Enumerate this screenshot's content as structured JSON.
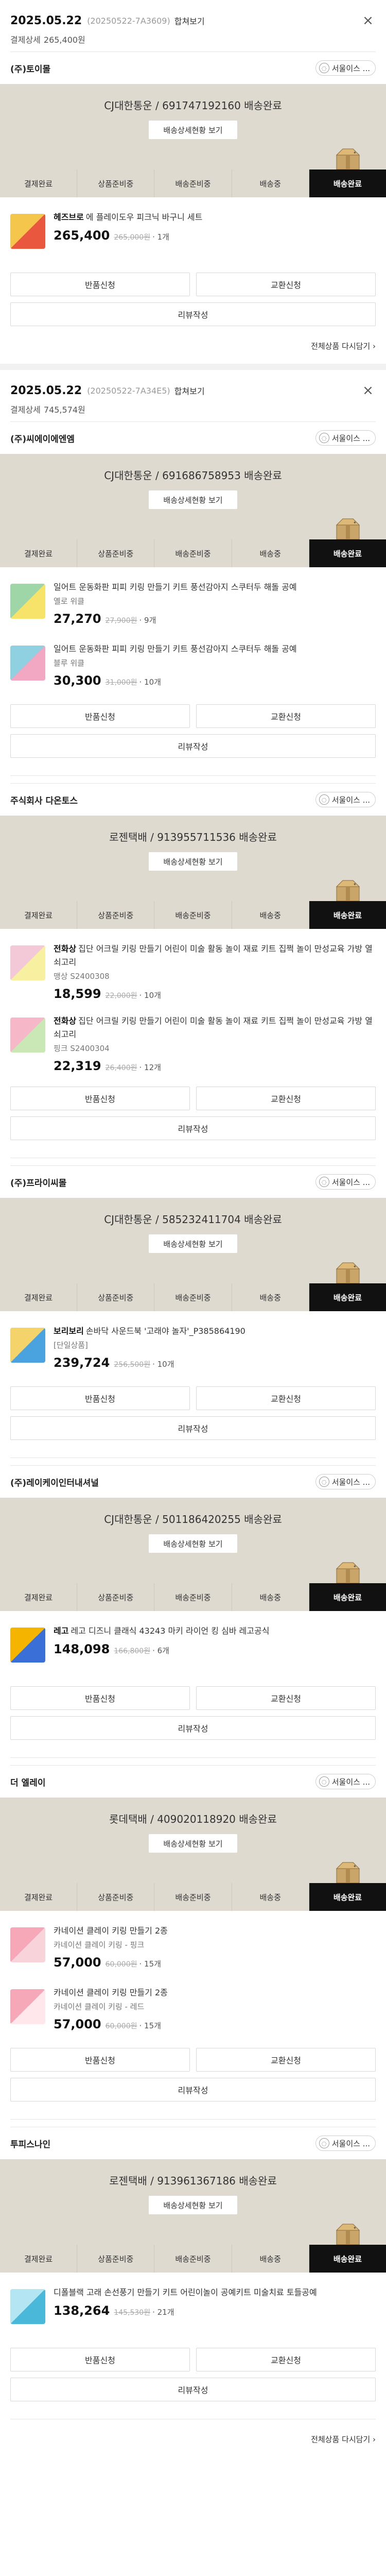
{
  "labels": {
    "merge": "합쳐보기",
    "pay_prefix": "결제상세",
    "seller_btn": "서울이스 ...",
    "seller_btn_icon": "chat-icon",
    "track": "배송상세현황 보기",
    "return": "반품신청",
    "exchange": "교환신청",
    "review": "리뷰작성",
    "reorder": "전체상품 다시담기 ›",
    "close": "×",
    "qty_suffix": "개"
  },
  "steps": [
    "결제완료",
    "상품준비중",
    "배송준비중",
    "배송중",
    "배송완료"
  ],
  "orders": [
    {
      "date": "2025.05.22",
      "no": "(20250522-7A3609)",
      "pay": "265,400원",
      "sellers": [
        {
          "name": "(주)토이몰",
          "carrier": "CJ대한통운 / 691747192160 배송완료",
          "products": [
            {
              "brand": "헤즈브로",
              "name": "에 플레이도우 피크닉 바구니 세트",
              "option": "",
              "price": "265,400",
              "orig": "265,000원",
              "qty": "· 1개"
            }
          ]
        }
      ]
    },
    {
      "date": "2025.05.22",
      "no": "(20250522-7A34E5)",
      "pay": "745,574원",
      "sellers": [
        {
          "name": "(주)씨에이에엔엠",
          "carrier": "CJ대한통운 / 691686758953 배송완료",
          "products": [
            {
              "brand": "",
              "name": "일어트 운동화판 피피 키링 만들기 키트 풍선감아지 스쿠터두 해돌 공예",
              "option": "옐로 위클",
              "price": "27,270",
              "orig": "27,900원",
              "qty": "· 9개"
            },
            {
              "brand": "",
              "name": "일어트 운동화판 피피 키링 만들기 키트 풍선감아지 스쿠터두 해돌 공예",
              "option": "블루 위클",
              "price": "30,300",
              "orig": "31,000원",
              "qty": "· 10개"
            }
          ]
        },
        {
          "name": "주식회사 다온토스",
          "carrier": "로젠택배 / 913955711536 배송완료",
          "products": [
            {
              "brand": "전화상",
              "name": "집단 어크릴 키링 만들기 어린이 미술 활동 놀이 재료 키트 집쩍 놀이 만성교육 가방 열쇠고리",
              "option": "맹상 S2400308",
              "price": "18,599",
              "orig": "22,000원",
              "qty": "· 10개"
            },
            {
              "brand": "전화상",
              "name": "집단 어크릴 키링 만들기 어린이 미술 활동 놀이 재료 키트 집쩍 놀이 만성교육 가방 열쇠고리",
              "option": "핑크 S2400304",
              "price": "22,319",
              "orig": "26,400원",
              "qty": "· 12개"
            }
          ]
        },
        {
          "name": "(주)프라이씨몰",
          "carrier": "CJ대한통운 / 585232411704 배송완료",
          "products": [
            {
              "brand": "보리보리",
              "name": "손바닥 사운드북 '고래야 놀자'_P385864190",
              "option": "[단일상품]",
              "price": "239,724",
              "orig": "256,500원",
              "qty": "· 10개"
            }
          ]
        },
        {
          "name": "(주)레이케이인터내셔널",
          "carrier": "CJ대한통운 / 501186420255 배송완료",
          "products": [
            {
              "brand": "레고",
              "name": "레고 디즈니 클래식 43243 마키 라이언 킹 심바 레고공식",
              "option": "",
              "price": "148,098",
              "orig": "166,800원",
              "qty": "· 6개"
            }
          ]
        },
        {
          "name": "더 엘레이",
          "carrier": "롯데택배 / 409020118920 배송완료",
          "products": [
            {
              "brand": "",
              "name": "카네이션 클레이 키링 만들기 2종",
              "option": "카네이션 클레이 키링 - 핑크",
              "price": "57,000",
              "orig": "60,000원",
              "qty": "· 15개"
            },
            {
              "brand": "",
              "name": "카네이션 클레이 키링 만들기 2종",
              "option": "카네이션 클레이 키링 - 레드",
              "price": "57,000",
              "orig": "60,000원",
              "qty": "· 15개"
            }
          ]
        },
        {
          "name": "투피스나인",
          "carrier": "로젠택배 / 913961367186 배송완료",
          "products": [
            {
              "brand": "",
              "name": "디폴블랙 고래 손선풍기 만들기 키트 어린이놀이 공예키트 미술치료 토들공예",
              "option": "",
              "price": "138,264",
              "orig": "145,530원",
              "qty": "· 21개"
            }
          ]
        }
      ]
    }
  ],
  "colors": {
    "band": "#dedad0",
    "active_step": "#111111",
    "divider": "#e5e5e5"
  }
}
